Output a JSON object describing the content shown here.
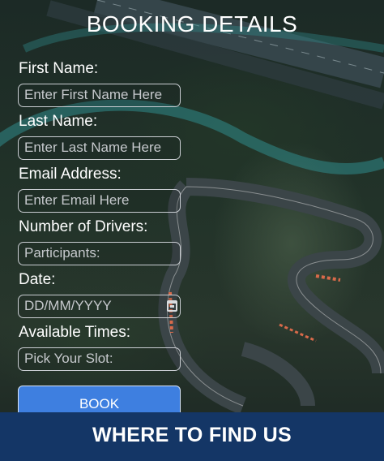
{
  "header": {
    "title": "BOOKING DETAILS"
  },
  "form": {
    "first_name": {
      "label": "First Name:",
      "placeholder": "Enter First Name Here"
    },
    "last_name": {
      "label": "Last Name:",
      "placeholder": "Enter Last Name Here"
    },
    "email": {
      "label": "Email Address:",
      "placeholder": "Enter Email Here"
    },
    "drivers": {
      "label": "Number of Drivers:",
      "placeholder": "Participants:"
    },
    "date": {
      "label": "Date:",
      "placeholder": "DD/MM/YYYY"
    },
    "times": {
      "label": "Available Times:",
      "placeholder": "Pick Your Slot:"
    },
    "submit_label": "BOOK"
  },
  "footer": {
    "title": "WHERE TO FIND US"
  },
  "icons": {
    "date_picker": "calendar-icon"
  },
  "colors": {
    "button": "#3e7fe0",
    "footer": "#143666"
  }
}
